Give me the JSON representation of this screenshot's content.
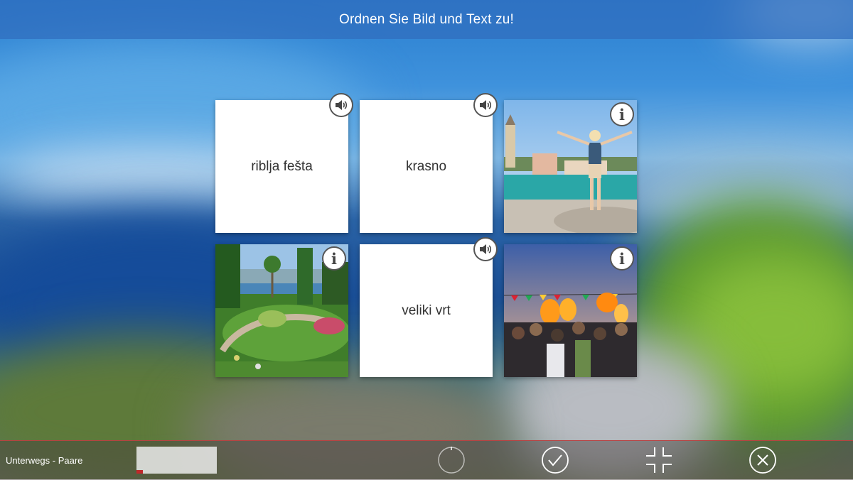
{
  "header": {
    "instruction": "Ordnen Sie Bild und Text zu!"
  },
  "cards": [
    {
      "kind": "text",
      "word": "riblja fešta",
      "icon": "speaker-icon"
    },
    {
      "kind": "text",
      "word": "krasno",
      "icon": "speaker-icon"
    },
    {
      "kind": "image",
      "scene": "woman-harbor-town",
      "icon": "info-icon"
    },
    {
      "kind": "image",
      "scene": "formal-garden",
      "icon": "info-icon"
    },
    {
      "kind": "text",
      "word": "veliki vrt",
      "icon": "speaker-icon"
    },
    {
      "kind": "image",
      "scene": "fire-festival-crowd",
      "icon": "info-icon"
    }
  ],
  "footer": {
    "title": "Unterwegs - Paare",
    "progress_fraction": 0.08,
    "controls": [
      "loading-circle-icon",
      "check-icon",
      "collapse-icon",
      "close-icon"
    ]
  },
  "colors": {
    "topbar": "#306EBE",
    "card": "#FFFFFF",
    "accent_red": "#C0282A",
    "text": "#333333"
  }
}
